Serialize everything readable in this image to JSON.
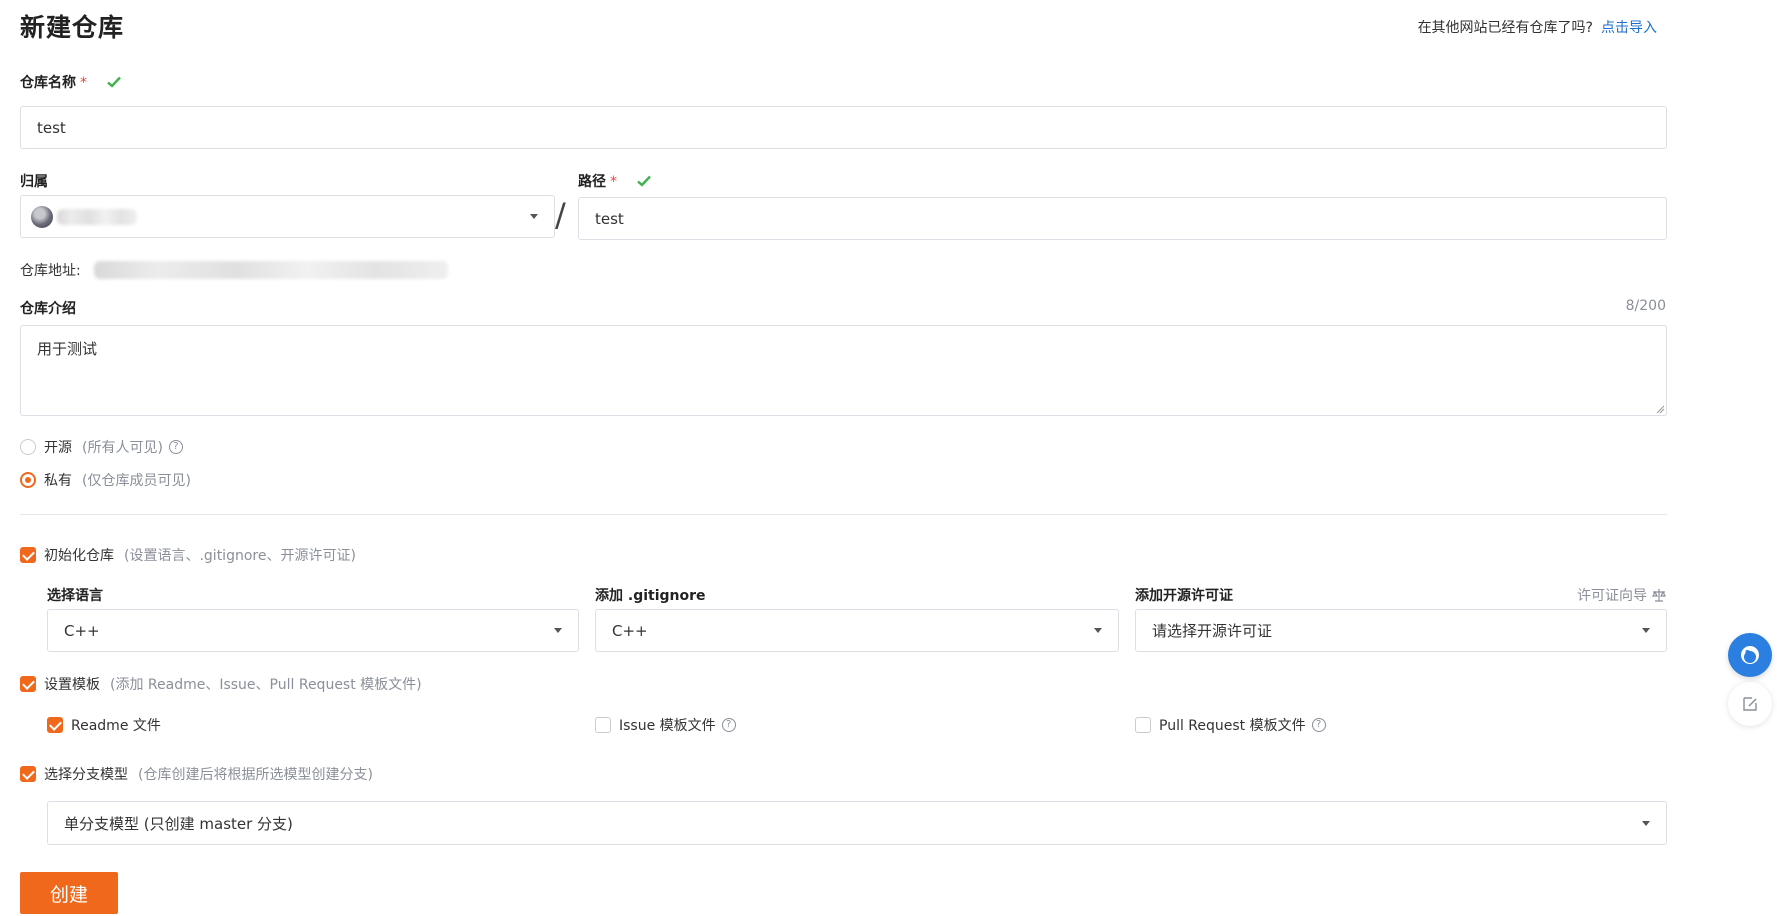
{
  "page_title": "新建仓库",
  "import": {
    "hint": "在其他网站已经有仓库了吗?",
    "link": "点击导入"
  },
  "repo_name": {
    "label": "仓库名称",
    "required_mark": "*",
    "value": "test"
  },
  "owner": {
    "label": "归属"
  },
  "separator": "/",
  "path": {
    "label": "路径",
    "required_mark": "*",
    "value": "test"
  },
  "address": {
    "label": "仓库地址:"
  },
  "intro": {
    "label": "仓库介绍",
    "count": "8/200",
    "value": "用于测试"
  },
  "visibility": {
    "options": [
      {
        "label": "开源",
        "sub": "(所有人可见)",
        "selected": false
      },
      {
        "label": "私有",
        "sub": "(仅仓库成员可见)",
        "selected": true
      }
    ]
  },
  "init_repo": {
    "label": "初始化仓库",
    "sub": "(设置语言、.gitignore、开源许可证)",
    "checked": true
  },
  "language": {
    "label": "选择语言",
    "value": "C++"
  },
  "gitignore": {
    "label": "添加 .gitignore",
    "value": "C++"
  },
  "license": {
    "label": "添加开源许可证",
    "guide": "许可证向导",
    "placeholder": "请选择开源许可证"
  },
  "template": {
    "label": "设置模板",
    "sub": "(添加 Readme、Issue、Pull Request 模板文件)",
    "checked": true,
    "readme": "Readme 文件",
    "issue": "Issue 模板文件",
    "pr": "Pull Request 模板文件"
  },
  "branch_model": {
    "label": "选择分支模型",
    "sub": "(仓库创建后将根据所选模型创建分支)",
    "checked": true,
    "value": "单分支模型 (只创建 master 分支)"
  },
  "create_button": "创建",
  "help_glyph": "?",
  "colors": {
    "accent": "#f0681c",
    "link": "#1e6ecc",
    "ok": "#3fb24f",
    "required": "#e5483a"
  }
}
